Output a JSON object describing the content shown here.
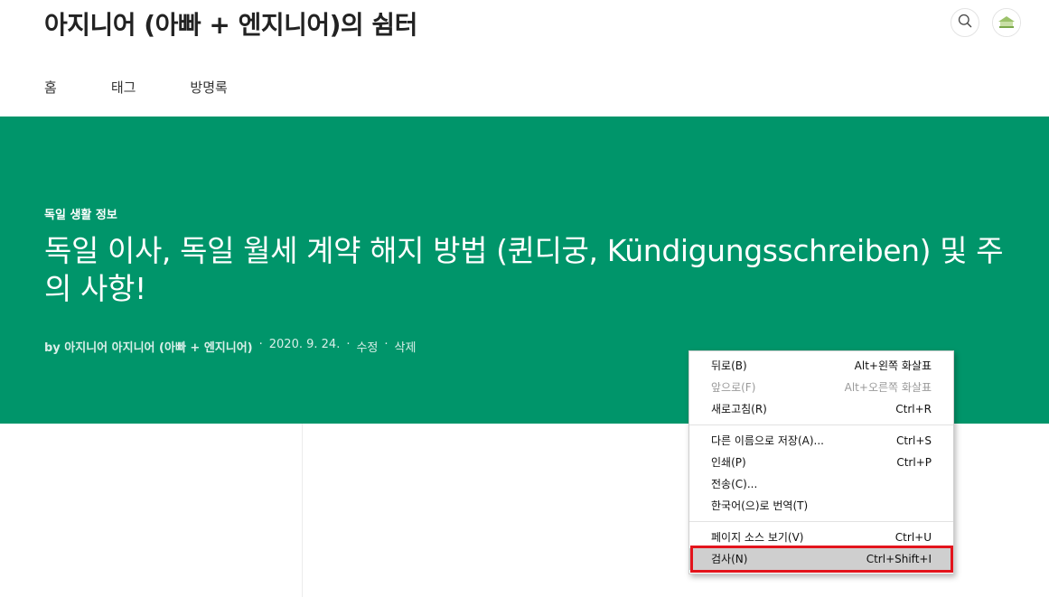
{
  "site": {
    "title": "아지니어 (아빠 + 엔지니어)의 쉼터",
    "search_icon": "search-icon",
    "avatar_icon": "blog-logo-avatar"
  },
  "nav": {
    "items": [
      {
        "label": "홈"
      },
      {
        "label": "태그"
      },
      {
        "label": "방명록"
      }
    ]
  },
  "post": {
    "category": "독일 생활 정보",
    "title": "독일 이사, 독일 월세 계약 해지 방법 (퀸디궁, Kündigungsschreiben) 및 주의 사항!",
    "author": "by 아지니어 아지니어 (아빠 + 엔지니어)",
    "sep": "·",
    "date": "2020. 9. 24.",
    "edit": "수정",
    "delete": "삭제"
  },
  "context_menu": {
    "groups": [
      [
        {
          "label": "뒤로(B)",
          "shortcut": "Alt+왼쪽 화살표"
        },
        {
          "label": "앞으로(F)",
          "shortcut": "Alt+오른쪽 화살표",
          "disabled": true
        },
        {
          "label": "새로고침(R)",
          "shortcut": "Ctrl+R"
        }
      ],
      [
        {
          "label": "다른 이름으로 저장(A)...",
          "shortcut": "Ctrl+S"
        },
        {
          "label": "인쇄(P)",
          "shortcut": "Ctrl+P"
        },
        {
          "label": "전송(C)...",
          "shortcut": ""
        },
        {
          "label": "한국어(으)로 번역(T)",
          "shortcut": ""
        }
      ],
      [
        {
          "label": "페이지 소스 보기(V)",
          "shortcut": "Ctrl+U"
        },
        {
          "label": "검사(N)",
          "shortcut": "Ctrl+Shift+I",
          "highlighted": true
        }
      ]
    ]
  },
  "colors": {
    "hero_bg": "#00956a",
    "highlight_border": "#e3141c"
  }
}
